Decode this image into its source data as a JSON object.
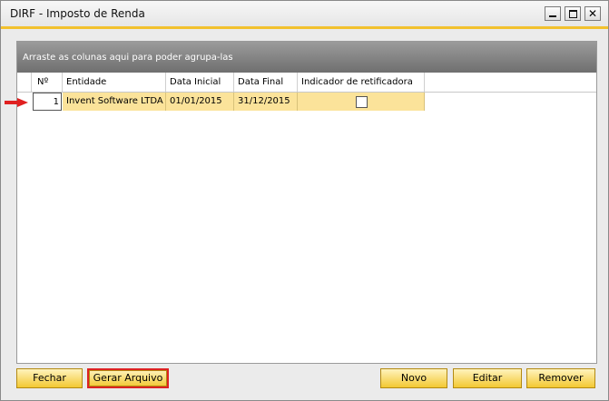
{
  "window": {
    "title": "DIRF - Imposto de Renda"
  },
  "grid": {
    "group_hint": "Arraste as colunas aqui para poder agrupa-las",
    "columns": [
      "Nº",
      "Entidade",
      "Data Inicial",
      "Data Final",
      "Indicador de retificadora"
    ],
    "rows": [
      {
        "num": "1",
        "entidade": "Invent Software LTDA",
        "data_inicial": "01/01/2015",
        "data_final": "31/12/2015",
        "retificadora": false
      }
    ]
  },
  "buttons": {
    "fechar": "Fechar",
    "gerar": "Gerar Arquivo",
    "novo": "Novo",
    "editar": "Editar",
    "remover": "Remover"
  },
  "colors": {
    "accent": "#f2c12e",
    "row_selected": "#fbe39a",
    "highlight": "#dd2222"
  }
}
